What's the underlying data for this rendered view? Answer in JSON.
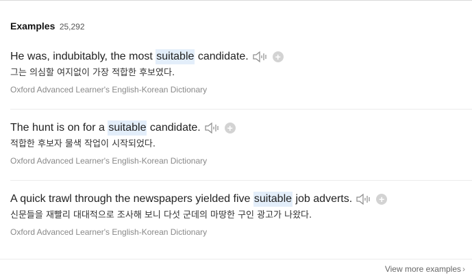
{
  "examples_section": {
    "title": "Examples",
    "count": "25,292"
  },
  "examples": [
    {
      "before": "He was, indubitably, the most ",
      "keyword": "suitable",
      "after": " candidate.",
      "translation": "그는 의심할 여지없이 가장 적합한 후보였다.",
      "source": "Oxford Advanced Learner's English-Korean Dictionary"
    },
    {
      "before": "The hunt is on for a ",
      "keyword": "suitable",
      "after": " candidate.",
      "translation": "적합한 후보자 물색 작업이 시작되었다.",
      "source": "Oxford Advanced Learner's English-Korean Dictionary"
    },
    {
      "before": "A quick trawl through the newspapers yielded five ",
      "keyword": "suitable",
      "after": " job adverts.",
      "translation": "신문들을 재빨리 대대적으로 조사해 보니 다섯 군데의 마땅한 구인 광고가 나왔다.",
      "source": "Oxford Advanced Learner's English-Korean Dictionary"
    }
  ],
  "icons": {
    "speaker": "speaker-icon",
    "add": "add-icon",
    "chevron": "chevron-right-icon"
  },
  "view_more": {
    "label": "View more examples",
    "chevron": "›"
  },
  "colors": {
    "keyword_highlight": "#e3eefa",
    "source_text": "#888888",
    "icon_gray": "#d3d3d3"
  }
}
